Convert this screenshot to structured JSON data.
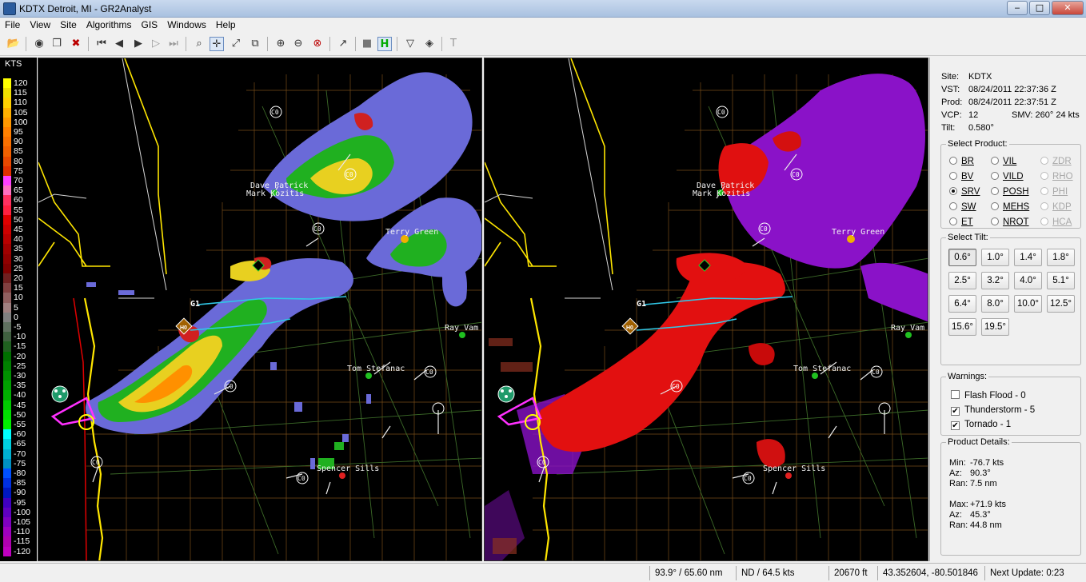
{
  "window": {
    "title": "KDTX Detroit, MI - GR2Analyst"
  },
  "menu": [
    "File",
    "View",
    "Site",
    "Algorithms",
    "GIS",
    "Windows",
    "Help"
  ],
  "legend": {
    "unit": "KTS",
    "labels": [
      "120",
      "115",
      "110",
      "105",
      "100",
      "95",
      "90",
      "85",
      "80",
      "75",
      "70",
      "65",
      "60",
      "55",
      "50",
      "45",
      "40",
      "35",
      "30",
      "25",
      "20",
      "15",
      "10",
      "5",
      "0",
      "-5",
      "-10",
      "-15",
      "-20",
      "-25",
      "-30",
      "-35",
      "-40",
      "-45",
      "-50",
      "-55",
      "-60",
      "-65",
      "-70",
      "-75",
      "-80",
      "-85",
      "-90",
      "-95",
      "-100",
      "-105",
      "-110",
      "-115",
      "-120"
    ],
    "colors": [
      "#ffff00",
      "#f0e000",
      "#ffd000",
      "#ffb000",
      "#ff9800",
      "#ff8000",
      "#f87000",
      "#f06000",
      "#e84800",
      "#e03000",
      "#ff40ff",
      "#ff70c0",
      "#ff3060",
      "#ff2040",
      "#e00000",
      "#cc0000",
      "#b80000",
      "#a00000",
      "#900000",
      "#800000",
      "#702020",
      "#804040",
      "#906060",
      "#a08080",
      "#808080",
      "#607060",
      "#406040",
      "#206020",
      "#007000",
      "#008000",
      "#009000",
      "#00a000",
      "#00b000",
      "#00c800",
      "#00e000",
      "#00f000",
      "#00ffff",
      "#00d0e0",
      "#00b0d0",
      "#0090c0",
      "#0050ff",
      "#0030e0",
      "#0018c0",
      "#4000c0",
      "#6000c0",
      "#8000c0",
      "#a000c0",
      "#b000b0",
      "#c000c0"
    ]
  },
  "radar": {
    "labels": {
      "spotter_1a": "Dave Patrick",
      "spotter_1b": "Mark Kozitis",
      "spotter_2": "Terry Green",
      "spotter_3": "Tom Stefanac",
      "spotter_4": "Spencer Sills",
      "spotter_5": "Ray Vam",
      "marker_c0": "C0",
      "marker_g1": "G1",
      "marker_h0": "H0"
    }
  },
  "site_info": {
    "site_label": "Site:",
    "site": "KDTX",
    "vst_label": "VST:",
    "vst": "08/24/2011  22:37:36 Z",
    "prod_label": "Prod:",
    "prod": "08/24/2011  22:37:51 Z",
    "vcp_label": "VCP:",
    "vcp": "12",
    "smv": "SMV: 260° 24 kts",
    "tilt_label": "Tilt:",
    "tilt": "0.580°"
  },
  "select_product": {
    "title": "Select Product:",
    "options": [
      {
        "label": "BR",
        "selected": false,
        "enabled": true
      },
      {
        "label": "VIL",
        "selected": false,
        "enabled": true
      },
      {
        "label": "ZDR",
        "selected": false,
        "enabled": false
      },
      {
        "label": "BV",
        "selected": false,
        "enabled": true
      },
      {
        "label": "VILD",
        "selected": false,
        "enabled": true
      },
      {
        "label": "RHO",
        "selected": false,
        "enabled": false
      },
      {
        "label": "SRV",
        "selected": true,
        "enabled": true
      },
      {
        "label": "POSH",
        "selected": false,
        "enabled": true
      },
      {
        "label": "PHI",
        "selected": false,
        "enabled": false
      },
      {
        "label": "SW",
        "selected": false,
        "enabled": true
      },
      {
        "label": "MEHS",
        "selected": false,
        "enabled": true
      },
      {
        "label": "KDP",
        "selected": false,
        "enabled": false
      },
      {
        "label": "ET",
        "selected": false,
        "enabled": true
      },
      {
        "label": "NROT",
        "selected": false,
        "enabled": true
      },
      {
        "label": "HCA",
        "selected": false,
        "enabled": false
      }
    ]
  },
  "select_tilt": {
    "title": "Select Tilt:",
    "tilts": [
      "0.6°",
      "1.0°",
      "1.4°",
      "1.8°",
      "2.5°",
      "3.2°",
      "4.0°",
      "5.1°",
      "6.4°",
      "8.0°",
      "10.0°",
      "12.5°",
      "15.6°",
      "19.5°"
    ],
    "selected": "0.6°"
  },
  "warnings": {
    "title": "Warnings:",
    "items": [
      {
        "label": "Flash Flood - 0",
        "checked": false
      },
      {
        "label": "Thunderstorm - 5",
        "checked": true
      },
      {
        "label": "Tornado - 1",
        "checked": true
      }
    ]
  },
  "product_details": {
    "title": "Product Details:",
    "min_label": "Min:",
    "min": "-76.7 kts",
    "az1_label": "Az:",
    "az1": "90.3°",
    "ran1_label": "Ran:",
    "ran1": "7.5 nm",
    "max_label": "Max:",
    "max": "+71.9 kts",
    "az2_label": "Az:",
    "az2": "45.3°",
    "ran2_label": "Ran:",
    "ran2": "44.8 nm"
  },
  "status": {
    "cursor": "93.9° / 65.60 nm",
    "value": "ND / 64.5 kts",
    "height": "20670 ft",
    "latlon": "43.352604, -80.501846",
    "next_update": "Next Update: 0:23"
  }
}
